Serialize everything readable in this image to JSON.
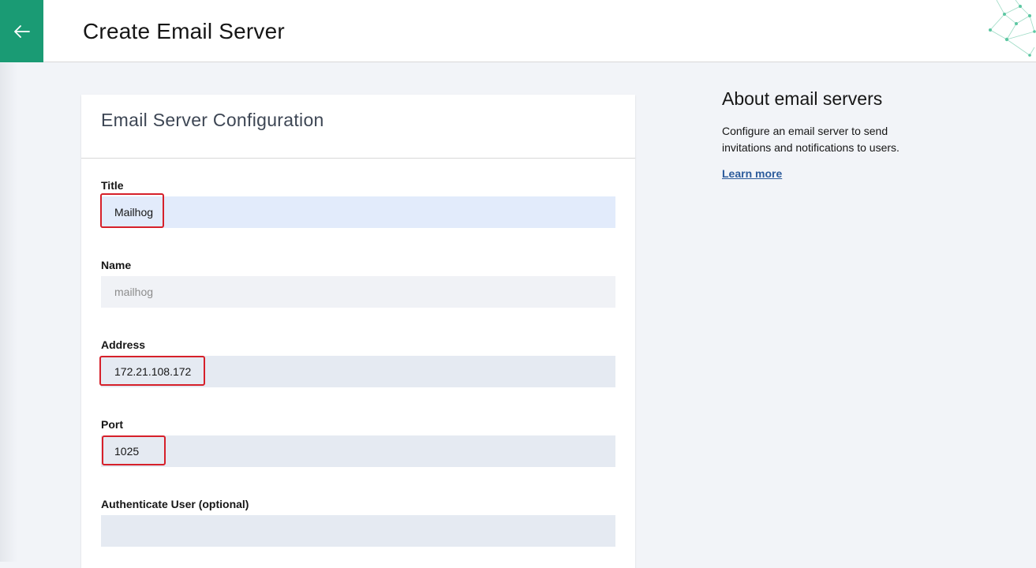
{
  "header": {
    "title": "Create Email Server",
    "back_icon": "arrow-left-icon",
    "accent_color": "#1a9b74"
  },
  "card": {
    "title": "Email Server Configuration",
    "fields": {
      "title": {
        "label": "Title",
        "value": "Mailhog"
      },
      "name": {
        "label": "Name",
        "value": "mailhog"
      },
      "address": {
        "label": "Address",
        "value": "172.21.108.172"
      },
      "port": {
        "label": "Port",
        "value": "1025"
      },
      "auth_user": {
        "label": "Authenticate User (optional)",
        "value": ""
      }
    }
  },
  "about": {
    "title": "About email servers",
    "description": "Configure an email server to send invitations and notifications to users.",
    "learn_more": "Learn more"
  },
  "colors": {
    "highlight": "#d6202a",
    "link": "#2d5c9c",
    "input_bg": "#e5eaf2",
    "input_active_bg": "#e2ebfb"
  }
}
